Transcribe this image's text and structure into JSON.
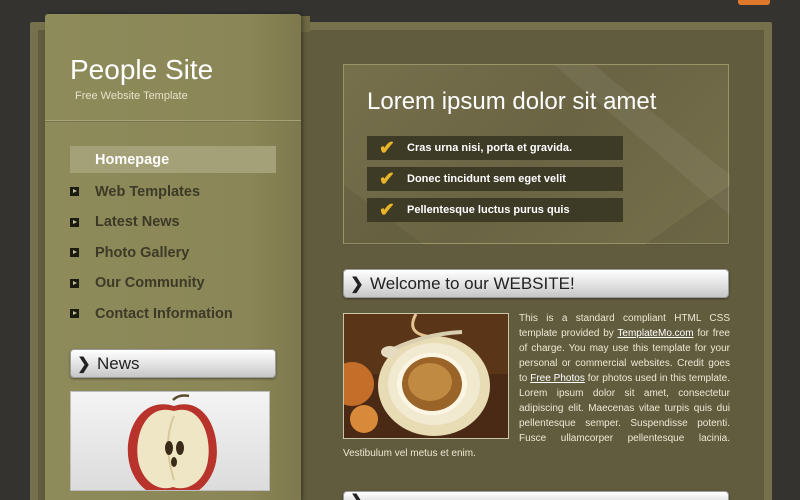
{
  "site": {
    "title": "People Site",
    "subtitle": "Free Website Template"
  },
  "nav": {
    "items": [
      {
        "label": "Homepage",
        "active": true
      },
      {
        "label": "Web Templates"
      },
      {
        "label": "Latest News"
      },
      {
        "label": "Photo Gallery"
      },
      {
        "label": "Our Community"
      },
      {
        "label": "Contact Information"
      }
    ]
  },
  "news": {
    "title": "News"
  },
  "banner": {
    "title": "Lorem ipsum dolor sit amet",
    "items": [
      "Cras urna nisi, porta et gravida.",
      "Donec tincidunt sem eget velit",
      "Pellentesque luctus purus quis"
    ]
  },
  "welcome": {
    "title": "Welcome to our WEBSITE!",
    "text_1": "This is a standard compliant HTML CSS template provided by",
    "link_1": "TemplateMo.com",
    "text_2": "for free of charge. You may use this template for your personal or commercial websites. Credit goes to",
    "link_2": "Free Photos",
    "text_3": "for photos used in this template. Lorem ipsum dolor sit amet, consectetur adipiscing elit. Maecenas vitae turpis quis dui pellentesque semper. Suspendisse potenti. Fusce ullamcorper pellentesque lacinia. Vestibulum vel metus et enim."
  },
  "colors": {
    "background": "#343330",
    "sidebar": "#8a8657",
    "content": "#625c3e",
    "accent_check": "#e8b42a",
    "active_nav": "#a4a077"
  },
  "icons": {
    "nav_bullet": "arrow-bullet-icon",
    "pill": "chevron-right-icon",
    "check": "check-icon"
  }
}
